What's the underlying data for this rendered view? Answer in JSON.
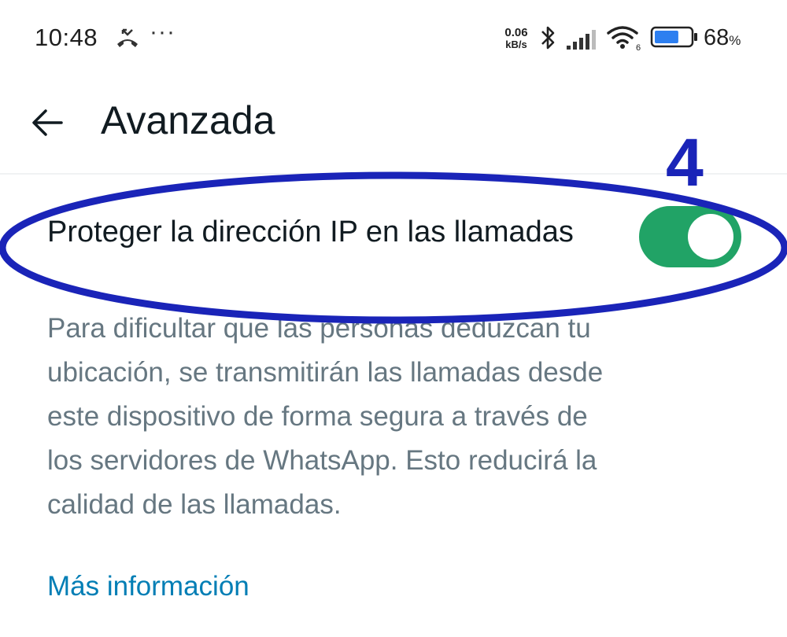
{
  "status_bar": {
    "time": "10:48",
    "more": "···",
    "net_speed_value": "0.06",
    "net_speed_unit": "kB/s",
    "wifi_label": "6",
    "battery_percent": "68",
    "battery_unit": "%",
    "battery_level": 0.68,
    "icons": [
      "missed-call-icon",
      "bluetooth-icon",
      "signal-icon",
      "wifi-icon",
      "battery-icon"
    ]
  },
  "app_bar": {
    "title": "Avanzada",
    "back_icon": "arrow-left-icon"
  },
  "setting": {
    "title": "Proteger la dirección IP en las llamadas",
    "enabled": true,
    "description": "Para dificultar que las personas deduzcan tu ubicación, se transmitirán las llamadas desde este dispositivo de forma segura a través de los servidores de WhatsApp. Esto reducirá la calidad de las llamadas.",
    "link": "Más información"
  },
  "annotation": {
    "step": "4",
    "color": "#1a24b8"
  },
  "colors": {
    "toggle_on": "#21a366",
    "link": "#027eb5",
    "secondary_text": "#667781",
    "primary_text": "#111b21"
  }
}
